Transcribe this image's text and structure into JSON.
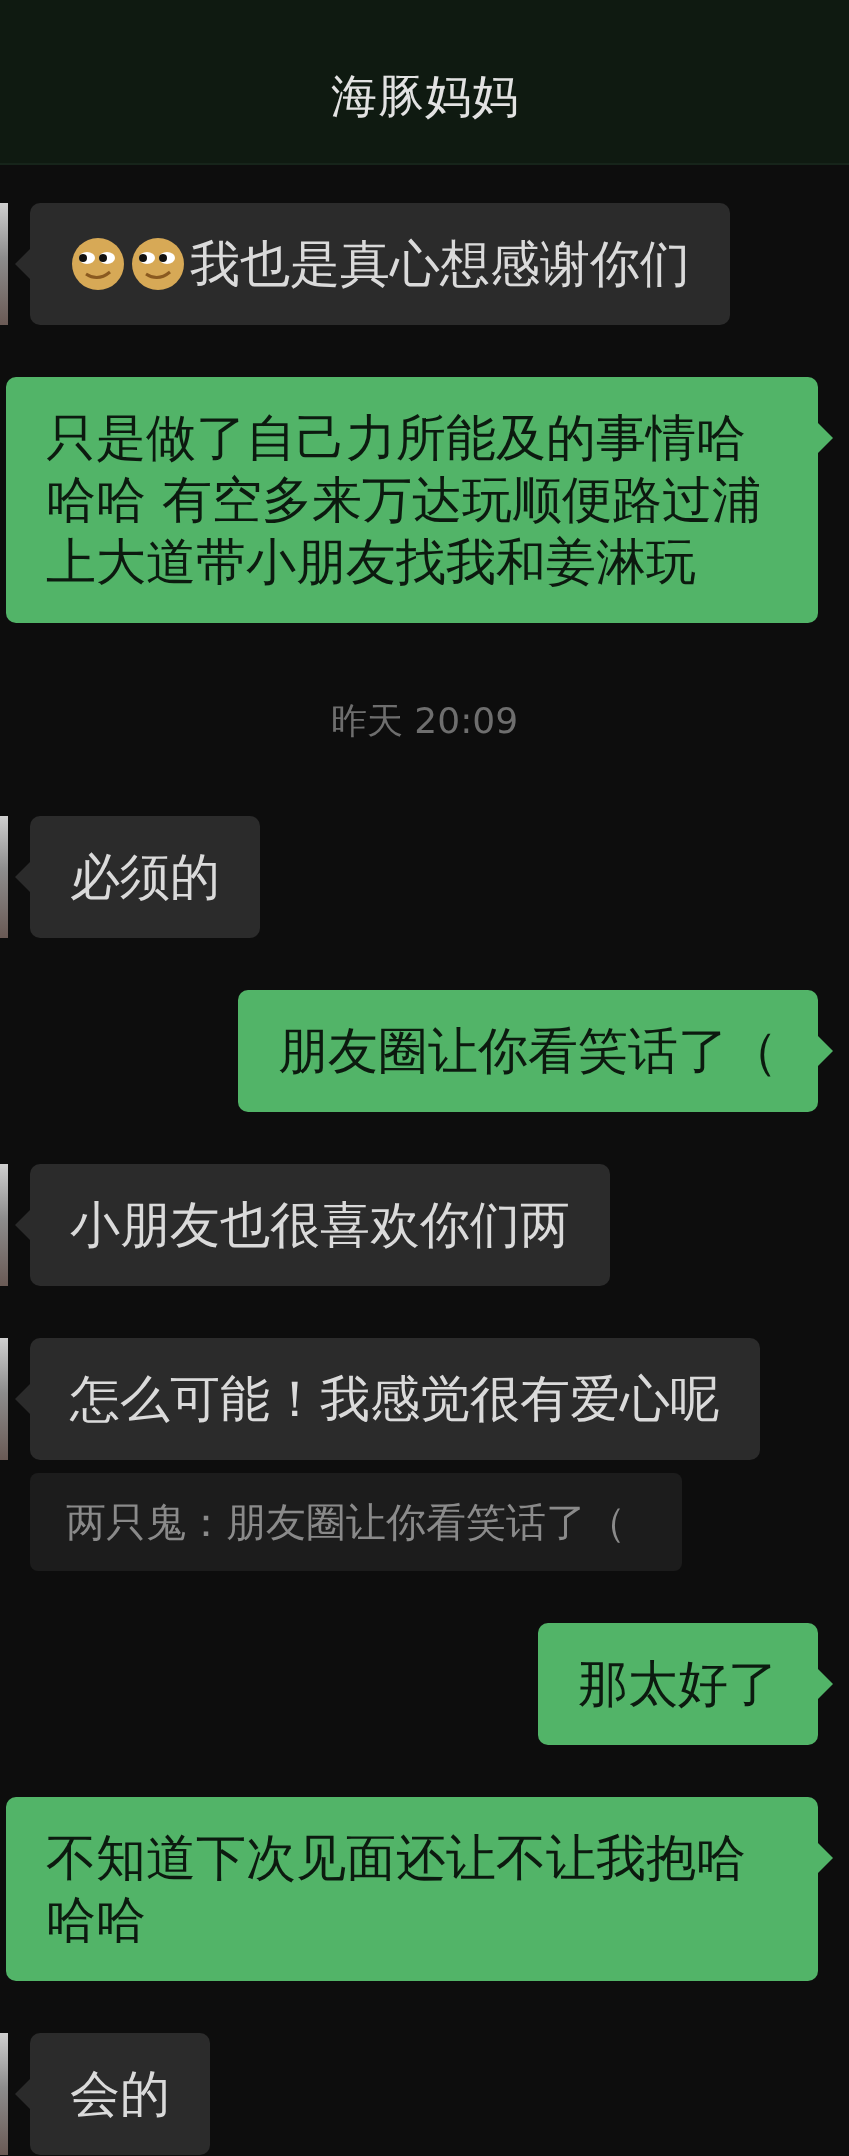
{
  "header": {
    "title": "海豚妈妈"
  },
  "messages": [
    {
      "kind": "incoming",
      "parts": [
        {
          "kind": "emoji"
        },
        {
          "kind": "emoji"
        },
        {
          "kind": "text",
          "text": "我也是真心想感谢你们"
        }
      ]
    },
    {
      "kind": "outgoing",
      "text": "只是做了自己力所能及的事情哈哈哈 有空多来万达玩顺便路过浦上大道带小朋友找我和姜淋玩"
    },
    {
      "kind": "time",
      "text": "昨天 20:09"
    },
    {
      "kind": "incoming",
      "text": "必须的"
    },
    {
      "kind": "outgoing",
      "text": "朋友圈让你看笑话了（"
    },
    {
      "kind": "incoming",
      "text": "小朋友也很喜欢你们两"
    },
    {
      "kind": "incoming",
      "text": "怎么可能！我感觉很有爱心呢",
      "quote": "两只鬼：朋友圈让你看笑话了（"
    },
    {
      "kind": "outgoing",
      "text": "那太好了"
    },
    {
      "kind": "outgoing",
      "text": "不知道下次见面还让不让我抱哈哈哈"
    },
    {
      "kind": "incoming",
      "text": "会的"
    }
  ]
}
